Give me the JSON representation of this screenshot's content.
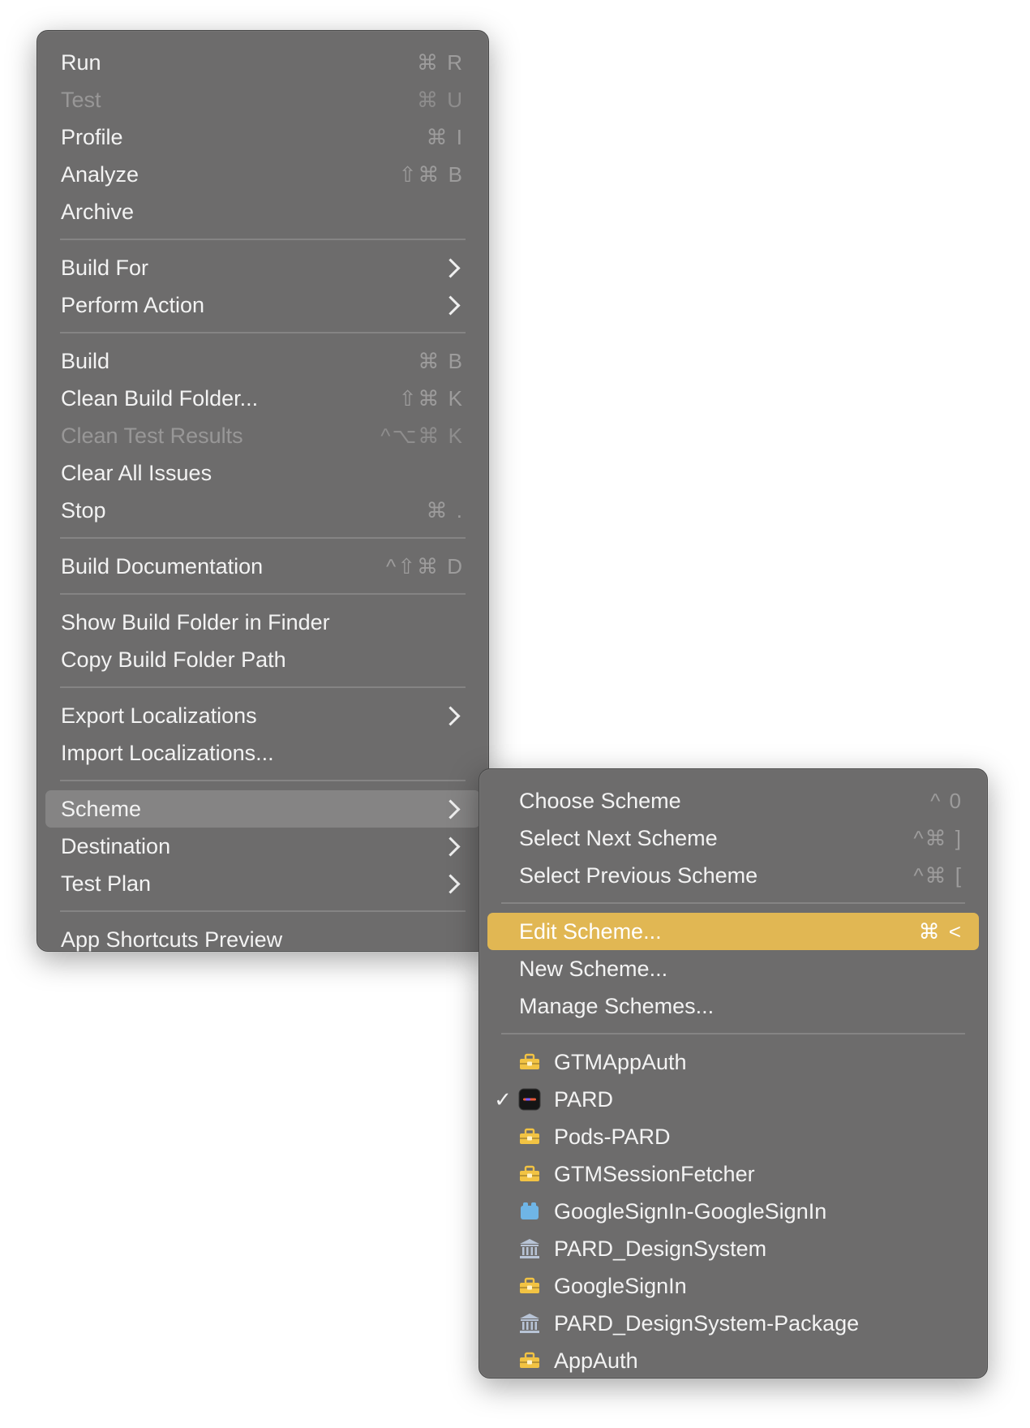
{
  "main_menu": {
    "groups": [
      [
        {
          "label": "Run",
          "shortcut": "⌘ R",
          "disabled": false
        },
        {
          "label": "Test",
          "shortcut": "⌘ U",
          "disabled": true
        },
        {
          "label": "Profile",
          "shortcut": "⌘ I",
          "disabled": false
        },
        {
          "label": "Analyze",
          "shortcut": "⇧⌘ B",
          "disabled": false
        },
        {
          "label": "Archive",
          "shortcut": "",
          "disabled": false
        }
      ],
      [
        {
          "label": "Build For",
          "submenu": true
        },
        {
          "label": "Perform Action",
          "submenu": true
        }
      ],
      [
        {
          "label": "Build",
          "shortcut": "⌘ B",
          "disabled": false
        },
        {
          "label": "Clean Build Folder...",
          "shortcut": "⇧⌘ K",
          "disabled": false
        },
        {
          "label": "Clean Test Results",
          "shortcut": "^⌥⌘ K",
          "disabled": true
        },
        {
          "label": "Clear All Issues",
          "shortcut": "",
          "disabled": false
        },
        {
          "label": "Stop",
          "shortcut": "⌘ .",
          "disabled": false
        }
      ],
      [
        {
          "label": "Build Documentation",
          "shortcut": "^⇧⌘ D",
          "disabled": false
        }
      ],
      [
        {
          "label": "Show Build Folder in Finder",
          "shortcut": ""
        },
        {
          "label": "Copy Build Folder Path",
          "shortcut": ""
        }
      ],
      [
        {
          "label": "Export Localizations",
          "submenu": true
        },
        {
          "label": "Import Localizations...",
          "shortcut": ""
        }
      ],
      [
        {
          "label": "Scheme",
          "submenu": true,
          "selected": true
        },
        {
          "label": "Destination",
          "submenu": true
        },
        {
          "label": "Test Plan",
          "submenu": true
        }
      ],
      [
        {
          "label": "App Shortcuts Preview",
          "shortcut": ""
        }
      ]
    ]
  },
  "scheme_menu": {
    "groups": [
      [
        {
          "label": "Choose Scheme",
          "shortcut": "^ 0"
        },
        {
          "label": "Select Next Scheme",
          "shortcut": "^⌘ ]"
        },
        {
          "label": "Select Previous Scheme",
          "shortcut": "^⌘ ["
        }
      ],
      [
        {
          "label": "Edit Scheme...",
          "shortcut": "⌘ <",
          "highlighted": true
        },
        {
          "label": "New Scheme...",
          "shortcut": ""
        },
        {
          "label": "Manage Schemes...",
          "shortcut": ""
        }
      ]
    ],
    "schemes": [
      {
        "label": "GTMAppAuth",
        "icon": "toolbox-icon",
        "checked": false
      },
      {
        "label": "PARD",
        "icon": "app-icon",
        "checked": true
      },
      {
        "label": "Pods-PARD",
        "icon": "toolbox-icon",
        "checked": false
      },
      {
        "label": "GTMSessionFetcher",
        "icon": "toolbox-icon",
        "checked": false
      },
      {
        "label": "GoogleSignIn-GoogleSignIn",
        "icon": "bundle-icon",
        "checked": false
      },
      {
        "label": "PARD_DesignSystem",
        "icon": "library-icon",
        "checked": false
      },
      {
        "label": "GoogleSignIn",
        "icon": "toolbox-icon",
        "checked": false
      },
      {
        "label": "PARD_DesignSystem-Package",
        "icon": "library-icon",
        "checked": false
      },
      {
        "label": "AppAuth",
        "icon": "toolbox-icon",
        "checked": false
      }
    ]
  },
  "colors": {
    "menu_bg": "#6d6c6c",
    "highlight": "#e1b753",
    "selected": "#858484",
    "toolbox": "#f2c343",
    "bundle": "#6fb5e6",
    "library": "#b8c4d6"
  }
}
